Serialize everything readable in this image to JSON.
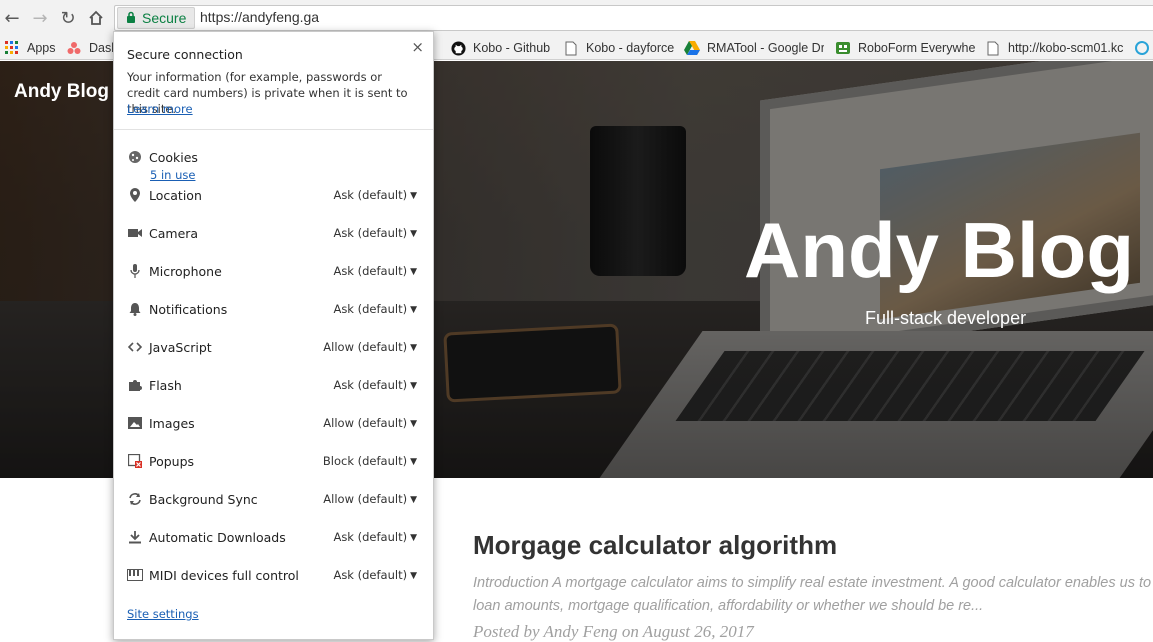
{
  "browser": {
    "secure_label": "Secure",
    "url": "https://andyfeng.ga"
  },
  "bookmarks": [
    {
      "label": "Apps",
      "icon": "apps-grid-icon"
    },
    {
      "label": "Dash",
      "icon": "asana-icon"
    },
    {
      "label": "Kobo - Github",
      "icon": "github-icon"
    },
    {
      "label": "Kobo - dayforce",
      "icon": "page-icon"
    },
    {
      "label": "RMATool - Google Dr",
      "icon": "google-drive-icon"
    },
    {
      "label": "RoboForm Everywher",
      "icon": "roboform-icon"
    },
    {
      "label": "http://kobo-scm01.kc",
      "icon": "page-icon"
    }
  ],
  "popup": {
    "heading": "Secure connection",
    "description": "Your information (for example, passwords or credit card numbers) is private when it is sent to this site.",
    "learn_more": "Learn more",
    "close": "×",
    "cookies": {
      "label": "Cookies",
      "link": "5 in use"
    },
    "permissions": [
      {
        "label": "Location",
        "value": "Ask (default)",
        "icon": "location-pin-icon"
      },
      {
        "label": "Camera",
        "value": "Ask (default)",
        "icon": "camera-icon"
      },
      {
        "label": "Microphone",
        "value": "Ask (default)",
        "icon": "microphone-icon"
      },
      {
        "label": "Notifications",
        "value": "Ask (default)",
        "icon": "bell-icon"
      },
      {
        "label": "JavaScript",
        "value": "Allow (default)",
        "icon": "code-icon"
      },
      {
        "label": "Flash",
        "value": "Ask (default)",
        "icon": "puzzle-icon"
      },
      {
        "label": "Images",
        "value": "Allow (default)",
        "icon": "image-icon"
      },
      {
        "label": "Popups",
        "value": "Block (default)",
        "icon": "popup-blocked-icon"
      },
      {
        "label": "Background Sync",
        "value": "Allow (default)",
        "icon": "sync-icon"
      },
      {
        "label": "Automatic Downloads",
        "value": "Ask (default)",
        "icon": "download-icon"
      },
      {
        "label": "MIDI devices full control",
        "value": "Ask (default)",
        "icon": "midi-keyboard-icon"
      }
    ],
    "site_settings": "Site settings"
  },
  "site": {
    "brand": "Andy Blog",
    "hero_title": "Andy Blog",
    "hero_subtitle": "Full-stack developer"
  },
  "post": {
    "title": "Morgage calculator algorithm",
    "excerpt_line1": "Introduction A mortgage calculator aims to simplify real estate investment. A good calculator enables us to det",
    "excerpt_line2": "loan amounts, mortgage qualification, affordability or whether we should be re...",
    "meta": "Posted by Andy Feng on August 26, 2017"
  }
}
